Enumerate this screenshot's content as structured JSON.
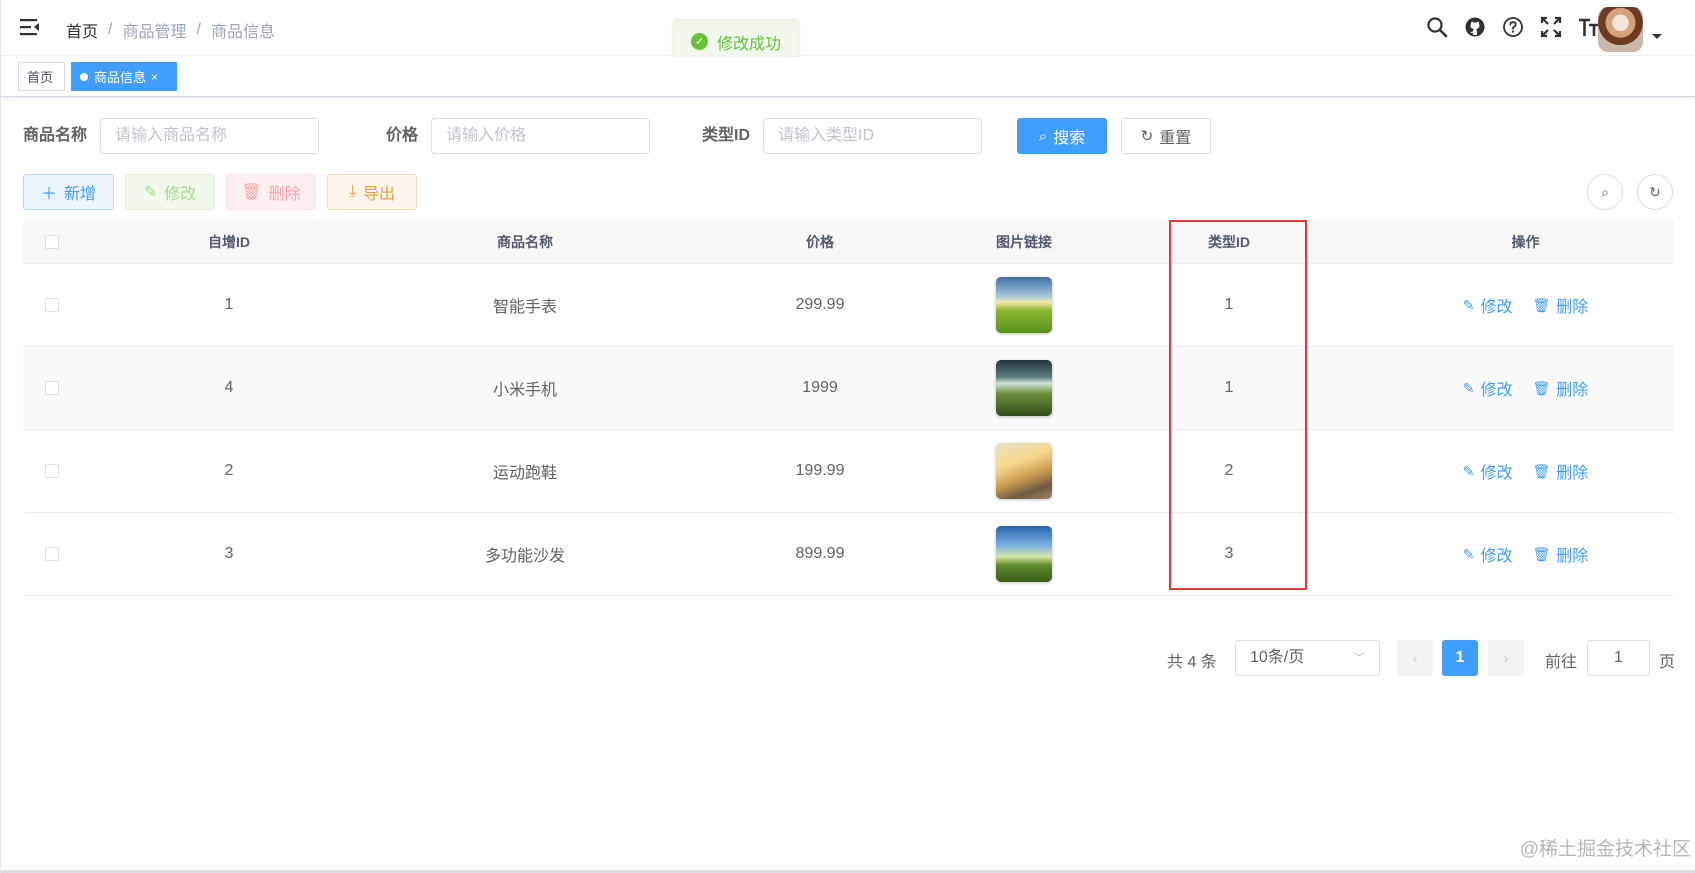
{
  "navbar": {
    "breadcrumb": [
      "首页",
      "商品管理",
      "商品信息"
    ],
    "breadcrumb_sep": "/",
    "icons": [
      "search-icon",
      "github-icon",
      "question-icon",
      "fullscreen-icon",
      "font-size-icon"
    ]
  },
  "toast": {
    "message": "修改成功",
    "color": "#67c23a"
  },
  "tags": {
    "home": "首页",
    "active": "商品信息",
    "close": "×"
  },
  "search": {
    "name_label": "商品名称",
    "name_placeholder": "请输入商品名称",
    "price_label": "价格",
    "price_placeholder": "请输入价格",
    "type_label": "类型ID",
    "type_placeholder": "请输入类型ID",
    "search_button": "搜索",
    "reset_button": "重置"
  },
  "toolbar": {
    "add": "新增",
    "edit": "修改",
    "delete": "删除",
    "export": "导出"
  },
  "table": {
    "headers": [
      "自增ID",
      "商品名称",
      "价格",
      "图片链接",
      "类型ID",
      "操作"
    ],
    "rows": [
      {
        "id": "1",
        "name": "智能手表",
        "price": "299.99",
        "type_id": "1"
      },
      {
        "id": "4",
        "name": "小米手机",
        "price": "1999",
        "type_id": "1"
      },
      {
        "id": "2",
        "name": "运动跑鞋",
        "price": "199.99",
        "type_id": "2"
      },
      {
        "id": "3",
        "name": "多功能沙发",
        "price": "899.99",
        "type_id": "3"
      }
    ],
    "row_edit": "修改",
    "row_delete": "删除",
    "highlight_color": "#e53935"
  },
  "pagination": {
    "total": "共 4 条",
    "page_size": "10条/页",
    "current_page": "1",
    "goto_label": "前往",
    "goto_value": "1",
    "page_suffix": "页"
  },
  "watermark": "@稀土掘金技术社区",
  "colors": {
    "primary": "#409eff",
    "success": "#67c23a",
    "warning": "#e6a23c",
    "danger": "#f56c6c"
  }
}
